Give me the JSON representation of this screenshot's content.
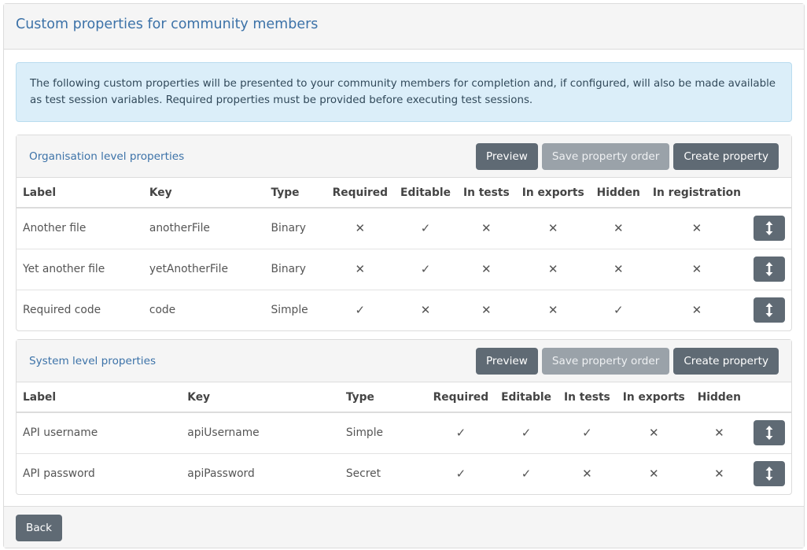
{
  "page": {
    "title": "Custom properties for community members",
    "info": "The following custom properties will be presented to your community members for completion and, if configured, will also be made available as test session variables. Required properties must be provided before executing test sessions."
  },
  "org_panel": {
    "title": "Organisation level properties",
    "buttons": {
      "preview": "Preview",
      "save_order": "Save property order",
      "create": "Create property"
    },
    "columns": [
      "Label",
      "Key",
      "Type",
      "Required",
      "Editable",
      "In tests",
      "In exports",
      "Hidden",
      "In registration"
    ],
    "rows": [
      {
        "label": "Another file",
        "key": "anotherFile",
        "type": "Binary",
        "flags": [
          "no",
          "yes",
          "no",
          "no",
          "no",
          "no"
        ]
      },
      {
        "label": "Yet another file",
        "key": "yetAnotherFile",
        "type": "Binary",
        "flags": [
          "no",
          "yes",
          "no",
          "no",
          "no",
          "no"
        ]
      },
      {
        "label": "Required code",
        "key": "code",
        "type": "Simple",
        "flags": [
          "yes",
          "no",
          "no",
          "no",
          "yes",
          "no"
        ]
      }
    ]
  },
  "sys_panel": {
    "title": "System level properties",
    "buttons": {
      "preview": "Preview",
      "save_order": "Save property order",
      "create": "Create property"
    },
    "columns": [
      "Label",
      "Key",
      "Type",
      "Required",
      "Editable",
      "In tests",
      "In exports",
      "Hidden"
    ],
    "rows": [
      {
        "label": "API username",
        "key": "apiUsername",
        "type": "Simple",
        "flags": [
          "yes",
          "yes",
          "yes",
          "no",
          "no"
        ]
      },
      {
        "label": "API password",
        "key": "apiPassword",
        "type": "Secret",
        "flags": [
          "yes",
          "yes",
          "no",
          "no",
          "no"
        ]
      }
    ]
  },
  "symbols": {
    "yes": "✓",
    "no": "✕"
  },
  "icons": {
    "move": "arrows-vertical-icon",
    "yes": "check-icon",
    "no": "cross-icon"
  },
  "footer": {
    "back": "Back"
  },
  "colors": {
    "accent": "#3c72a8",
    "button": "#5f6a74",
    "button_disabled": "#9aa2a9",
    "info_bg": "#dbeef9"
  }
}
